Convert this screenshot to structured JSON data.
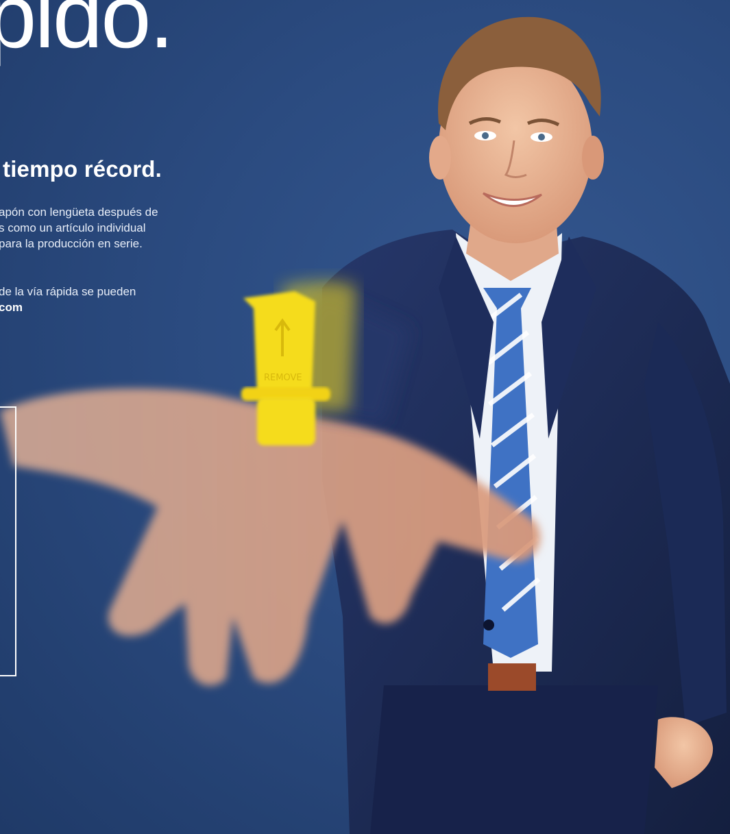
{
  "hero": {
    "headline": "pido.",
    "subheadline": "tiempo récord.",
    "body_lines": [
      "apón con lengüeta después de",
      "s como un artículo individual",
      "para la producción en serie."
    ],
    "note_lines": [
      "de la vía rápida se pueden"
    ],
    "link_text": "com"
  },
  "photo": {
    "product_label": "REMOVE"
  },
  "colors": {
    "background": "#2b4b80",
    "text": "#ffffff",
    "product": "#f5dc1e",
    "suit": "#1d2b52",
    "tie_blue": "#3f72c4"
  }
}
